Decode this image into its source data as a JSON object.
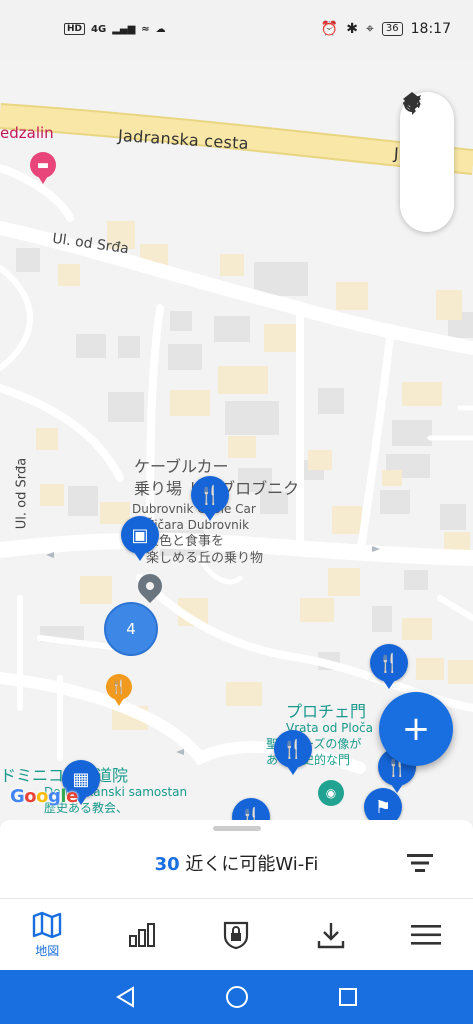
{
  "status_bar": {
    "left_badges": [
      "HD",
      "4G",
      "...",
      "☁"
    ],
    "time": "18:17",
    "battery": "36"
  },
  "map": {
    "road_main": "Jadranska cesta",
    "road_main_partial": "J",
    "road_srda": "Ul. od Srđa",
    "road_srda_vertical": "Ul. od Srđa",
    "place_medzalin": "edzalin",
    "cable_car_jp_line1": "ケーブルカー",
    "cable_car_jp_line2": "乗り場 ドゥブロブニク",
    "cable_car_en_line1": "Dubrovnik Cable Car",
    "cable_car_en_line2": "Žičara Dubrovnik",
    "cable_car_desc_line1": "景色と食事を",
    "cable_car_desc_line2": "楽しめる丘の乗り物",
    "ploce_jp": "プロチェ門",
    "ploce_en": "Vrata od Ploča",
    "ploce_desc_line1": "聖ブレーズの像が",
    "ploce_desc_line2": "ある歴史的な門",
    "dominik_jp": "ドミニコ会修道院",
    "dominik_en": "Dominikanski samostan",
    "dominik_desc": "歴史ある教会、",
    "cluster_count": "4",
    "google_logo": "Google"
  },
  "sheet": {
    "count": "30",
    "title": " 近くに可能Wi-Fi"
  },
  "bottom_nav": {
    "items": [
      {
        "icon": "map-icon",
        "label": "地図"
      },
      {
        "icon": "chart-icon",
        "label": ""
      },
      {
        "icon": "vpn-shield-icon",
        "label": ""
      },
      {
        "icon": "download-icon",
        "label": ""
      },
      {
        "icon": "menu-icon",
        "label": ""
      }
    ]
  },
  "colors": {
    "accent": "#1a6fe0",
    "road_major": "#f8e7a6",
    "teal_label": "#1a9a8c"
  }
}
